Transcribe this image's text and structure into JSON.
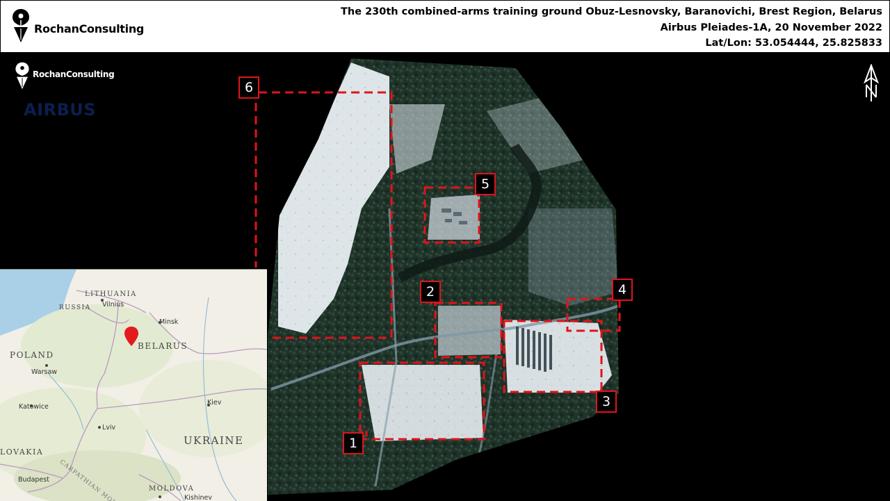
{
  "header": {
    "brand": "RochanConsulting",
    "title": "The 230th combined-arms training ground Obuz-Lesnovsky, Baranovichi, Brest Region, Belarus",
    "source": "Airbus Pleiades-1A, 20 November 2022",
    "coords": "Lat/Lon:  53.054444, 25.825833"
  },
  "watermark": {
    "brand": "RochanConsulting",
    "airbus": "AIRBUS"
  },
  "icons": {
    "logo": "rochan-pen-nib-logo-icon",
    "north": "north-arrow-icon",
    "pin": "location-pin-icon"
  },
  "colors": {
    "accent_red": "#e0141a",
    "airbus_blue": "#0b1f4e",
    "forest": "#1f3329",
    "snow": "#eef2f4"
  },
  "markers": [
    {
      "label": "1"
    },
    {
      "label": "2"
    },
    {
      "label": "3"
    },
    {
      "label": "4"
    },
    {
      "label": "5"
    },
    {
      "label": "6"
    }
  ],
  "inset_map": {
    "countries": [
      "LITHUANIA",
      "RUSSIA",
      "BELARUS",
      "POLAND",
      "UKRAINE",
      "LOVAKIA",
      "MOLDOVA"
    ],
    "cities": [
      "Vilnius",
      "Minsk",
      "Warsaw",
      "Katowice",
      "Lviv",
      "Kiev",
      "Budapest",
      "Kishinev"
    ],
    "features": [
      "CARPATHIAN MOUNTA"
    ]
  }
}
